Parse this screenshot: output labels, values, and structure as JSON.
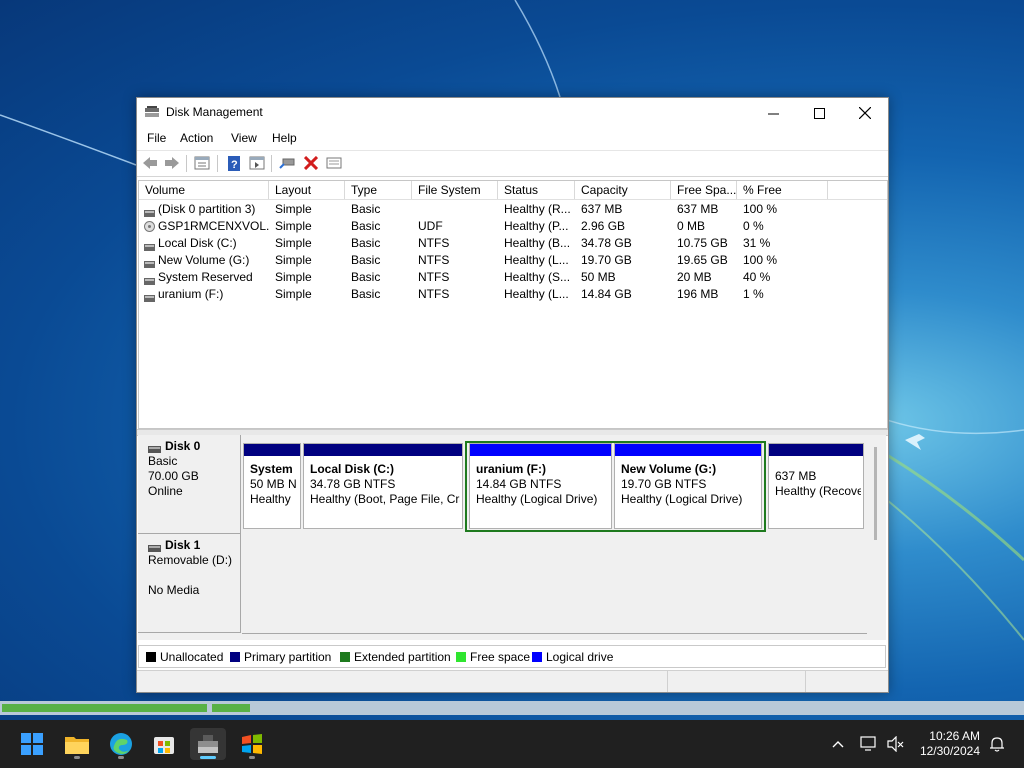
{
  "window": {
    "title": "Disk Management",
    "controls": {
      "minimize": "minimize",
      "maximize": "maximize",
      "close": "close"
    }
  },
  "menu": [
    "File",
    "Action",
    "View",
    "Help"
  ],
  "toolbar_icons": [
    "back-arrow-icon",
    "forward-arrow-icon",
    "properties-icon",
    "help-icon",
    "details-pane-icon",
    "connect-icon",
    "delete-icon",
    "list-view-icon"
  ],
  "volume_list": {
    "columns": [
      "Volume",
      "Layout",
      "Type",
      "File System",
      "Status",
      "Capacity",
      "Free Spa...",
      "% Free"
    ],
    "rows": [
      {
        "volume": "(Disk 0 partition 3)",
        "layout": "Simple",
        "type": "Basic",
        "fs": "",
        "status": "Healthy (R...",
        "capacity": "637 MB",
        "free": "637 MB",
        "pct": "100 %",
        "icon": "drive-icon"
      },
      {
        "volume": "GSP1RMCENXVOL...",
        "layout": "Simple",
        "type": "Basic",
        "fs": "UDF",
        "status": "Healthy (P...",
        "capacity": "2.96 GB",
        "free": "0 MB",
        "pct": "0 %",
        "icon": "cd-drive-icon"
      },
      {
        "volume": "Local Disk (C:)",
        "layout": "Simple",
        "type": "Basic",
        "fs": "NTFS",
        "status": "Healthy (B...",
        "capacity": "34.78 GB",
        "free": "10.75 GB",
        "pct": "31 %",
        "icon": "drive-icon"
      },
      {
        "volume": "New Volume (G:)",
        "layout": "Simple",
        "type": "Basic",
        "fs": "NTFS",
        "status": "Healthy (L...",
        "capacity": "19.70 GB",
        "free": "19.65 GB",
        "pct": "100 %",
        "icon": "drive-icon"
      },
      {
        "volume": "System Reserved",
        "layout": "Simple",
        "type": "Basic",
        "fs": "NTFS",
        "status": "Healthy (S...",
        "capacity": "50 MB",
        "free": "20 MB",
        "pct": "40 %",
        "icon": "drive-icon"
      },
      {
        "volume": "uranium (F:)",
        "layout": "Simple",
        "type": "Basic",
        "fs": "NTFS",
        "status": "Healthy (L...",
        "capacity": "14.84 GB",
        "free": "196 MB",
        "pct": "1 %",
        "icon": "drive-icon"
      }
    ]
  },
  "disks": {
    "disk0": {
      "name": "Disk 0",
      "type": "Basic",
      "size": "70.00 GB",
      "state": "Online",
      "partitions": [
        {
          "name": "System",
          "size": "50 MB N",
          "status": "Healthy",
          "bar_color": "#000080"
        },
        {
          "name": "Local Disk  (C:)",
          "size": "34.78 GB NTFS",
          "status": "Healthy (Boot, Page File, Cra",
          "bar_color": "#000080"
        },
        {
          "name": "uranium  (F:)",
          "size": "14.84 GB NTFS",
          "status": "Healthy (Logical Drive)",
          "bar_color": "#0000ff"
        },
        {
          "name": "New Volume  (G:)",
          "size": "19.70 GB NTFS",
          "status": "Healthy (Logical Drive)",
          "bar_color": "#0000ff"
        },
        {
          "name": "",
          "size": "637 MB",
          "status": "Healthy (Recove",
          "bar_color": "#000080"
        }
      ]
    },
    "disk1": {
      "name": "Disk 1",
      "type": "Removable (D:)",
      "media": "No Media"
    }
  },
  "legend": [
    {
      "label": "Unallocated",
      "color": "#000000"
    },
    {
      "label": "Primary partition",
      "color": "#000080"
    },
    {
      "label": "Extended partition",
      "color": "#1e7a1e"
    },
    {
      "label": "Free space",
      "color": "#2fe52f"
    },
    {
      "label": "Logical drive",
      "color": "#0000ff"
    }
  ],
  "taskbar": {
    "apps": [
      "start-icon",
      "file-explorer-icon",
      "edge-icon",
      "store-icon",
      "disk-management-icon",
      "windows-logo-icon"
    ],
    "time": "10:26 AM",
    "date": "12/30/2024"
  }
}
